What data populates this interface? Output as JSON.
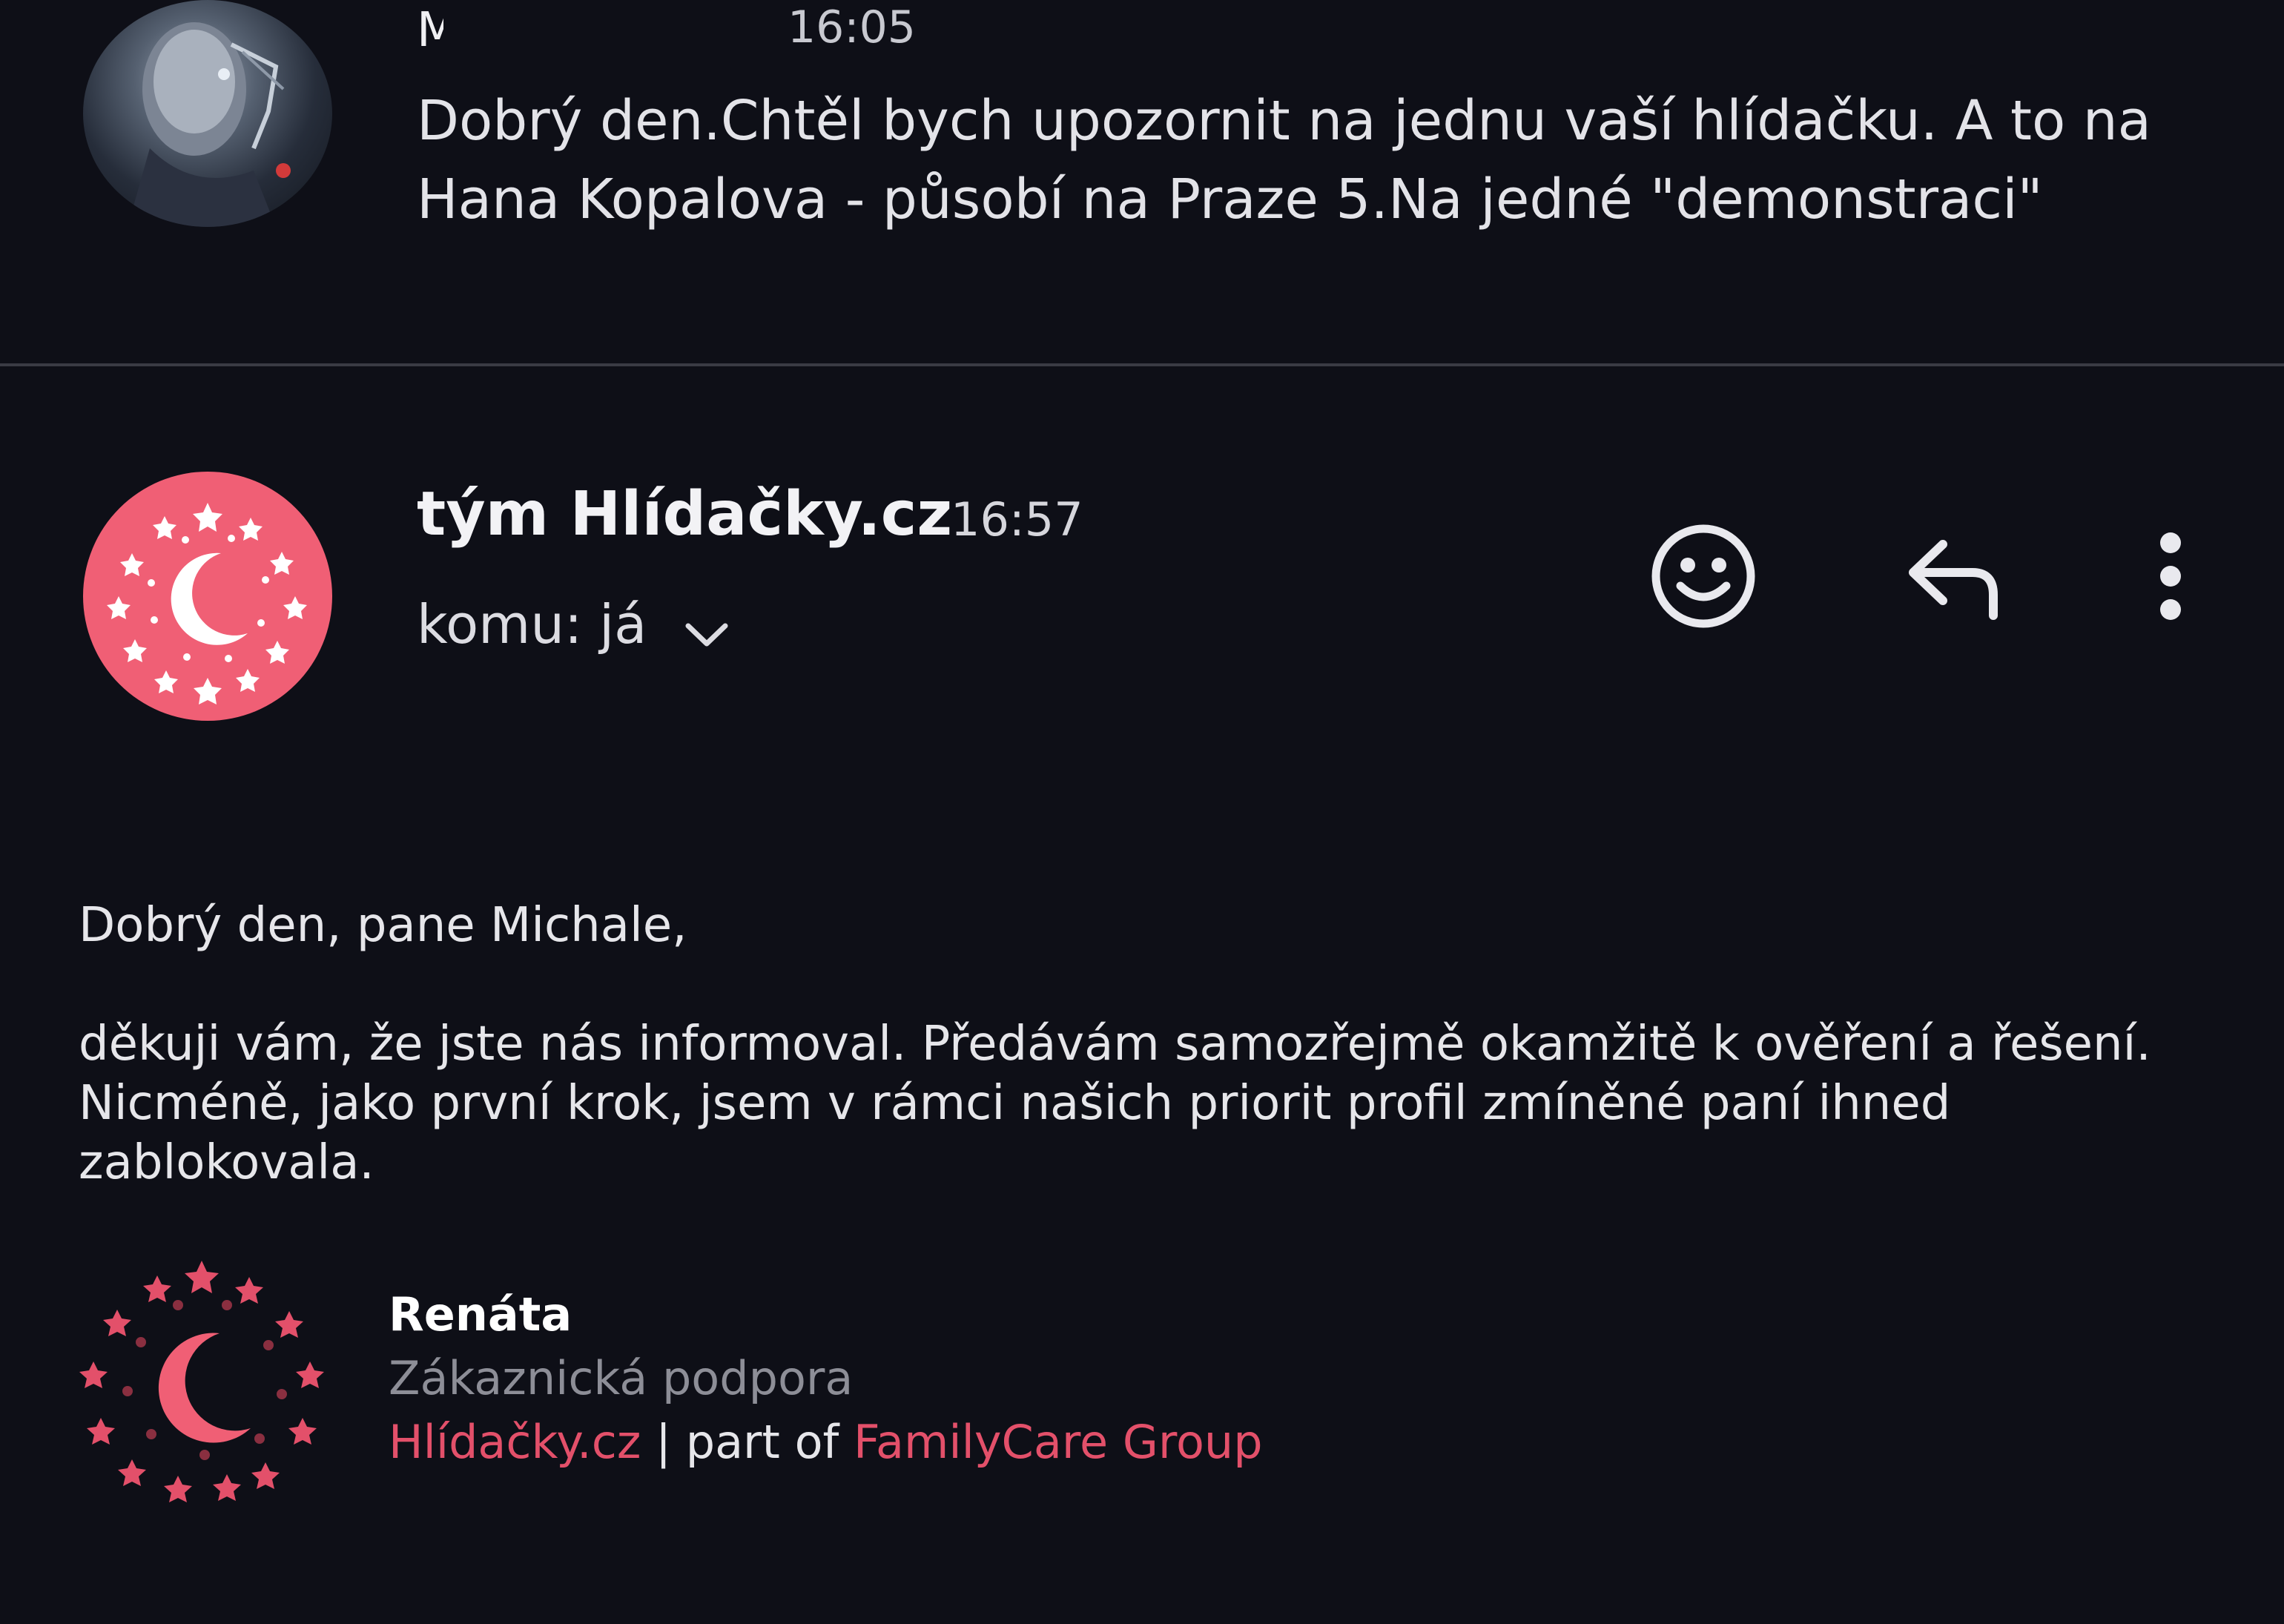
{
  "message1": {
    "sender_visible": "M                    .",
    "time": "16:05",
    "preview": "Dobrý den.Chtěl bych upozornit na jednu vaší hlídačku. A to na Hana Kopalova - působí na Praze 5.Na jedné \"demonstraci\"",
    "avatar_icon": "cyborg-avatar"
  },
  "message2": {
    "sender": "tým Hlídačky.cz",
    "time": "16:57",
    "recipient": "komu: já",
    "avatar_icon": "moon-stars-logo",
    "actions": [
      {
        "icon": "smiley-icon"
      },
      {
        "icon": "reply-icon"
      },
      {
        "icon": "more-vert-icon"
      }
    ],
    "body": {
      "greeting": "Dobrý den, pane Michale,",
      "paragraph": "děkuji vám, že jste nás informoval. Předávám samozřejmě okamžitě k ověření a  řešení. Nicméně, jako první krok, jsem v rámci našich priorit profil zmíněné paní ihned zablokovala."
    },
    "signature": {
      "name": "Renáta",
      "role": "Zákaznická podpora",
      "brand": "Hlídačky.cz",
      "separator": " | part of ",
      "group": "FamilyCare Group",
      "logo_icon": "moon-stars-logo"
    }
  },
  "colors": {
    "background": "#0e0f17",
    "accent": "#f05f75",
    "link": "#e3506a",
    "muted": "#8d8e97"
  }
}
